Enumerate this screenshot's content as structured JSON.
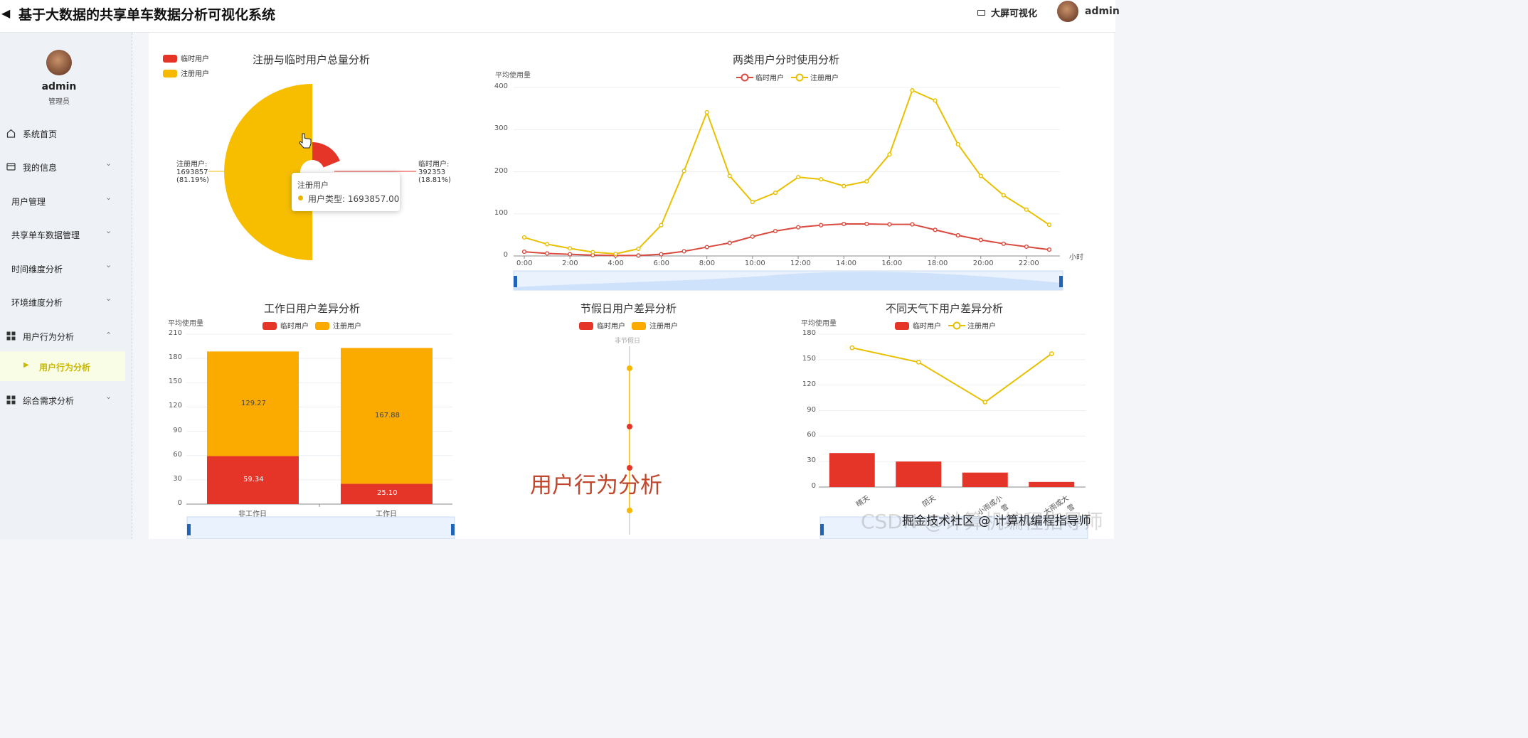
{
  "topbar": {
    "title": "基于大数据的共享单车数据分析可视化系统",
    "big_screen_label": "大屏可视化",
    "user": "admin"
  },
  "sidebar": {
    "username": "admin",
    "role": "管理员",
    "items": [
      {
        "label": "系统首页",
        "icon": "home-icon"
      },
      {
        "label": "我的信息",
        "icon": "card-icon"
      },
      {
        "label": "用户管理"
      },
      {
        "label": "共享单车数据管理"
      },
      {
        "label": "时间维度分析"
      },
      {
        "label": "环境维度分析"
      },
      {
        "label": "用户行为分析",
        "icon": "grid-icon"
      },
      {
        "label": "用户行为分析"
      },
      {
        "label": "综合需求分析",
        "icon": "grid-icon"
      }
    ]
  },
  "colors": {
    "temp": "#e53428",
    "reg": "#f7b900",
    "reg_bar": "#fbab00"
  },
  "overlay_text": "用户行为分析",
  "watermark_text": "CSDN @计算机编程指导师",
  "watermark_credit": "掘金技术社区 @ 计算机编程指导师",
  "charts": {
    "pie": {
      "title": "注册与临时用户总量分析",
      "legend": [
        "临时用户",
        "注册用户"
      ],
      "reg_label": [
        "注册用户:",
        "1693857",
        "(81.19%)"
      ],
      "temp_label": [
        "临时用户:",
        "392353",
        "(18.81%)"
      ],
      "tooltip_title": "注册用户",
      "tooltip_value": "用户类型: 1693857.00"
    },
    "line": {
      "title": "两类用户分时使用分析",
      "legend": [
        "临时用户",
        "注册用户"
      ],
      "ylabel": "平均使用量",
      "xunit": "小时",
      "yticks": [
        "0",
        "100",
        "200",
        "300",
        "400"
      ],
      "xticks": [
        "0:00",
        "2:00",
        "4:00",
        "6:00",
        "8:00",
        "10:00",
        "12:00",
        "14:00",
        "16:00",
        "18:00",
        "20:00",
        "22:00"
      ]
    },
    "workday": {
      "title": "工作日用户差异分析",
      "legend": [
        "临时用户",
        "注册用户"
      ],
      "ylabel": "平均使用量",
      "yticks": [
        "0",
        "30",
        "60",
        "90",
        "120",
        "150",
        "180",
        "210"
      ],
      "categories": [
        "非工作日",
        "工作日"
      ],
      "temp_labels": [
        "59.34",
        "25.10"
      ],
      "reg_labels": [
        "129.27",
        "167.88"
      ]
    },
    "holiday": {
      "title": "节假日用户差异分析",
      "legend": [
        "临时用户",
        "注册用户"
      ],
      "category": "非节假日"
    },
    "weather": {
      "title": "不同天气下用户差异分析",
      "legend": [
        "临时用户",
        "注册用户"
      ],
      "ylabel": "平均使用量",
      "yticks": [
        "0",
        "30",
        "60",
        "90",
        "120",
        "150",
        "180"
      ],
      "categories": [
        "晴天",
        "阴天",
        "小雨或小雪",
        "大雨或大雪"
      ]
    }
  },
  "chart_data": [
    {
      "type": "pie",
      "title": "注册与临时用户总量分析",
      "categories": [
        "注册用户",
        "临时用户"
      ],
      "values": [
        1693857,
        392353
      ],
      "percent": [
        81.19,
        18.81
      ]
    },
    {
      "type": "line",
      "title": "两类用户分时使用分析",
      "ylabel": "平均使用量",
      "xlabel": "小时",
      "ylim": [
        0,
        400
      ],
      "x": [
        "0:00",
        "1:00",
        "2:00",
        "3:00",
        "4:00",
        "5:00",
        "6:00",
        "7:00",
        "8:00",
        "9:00",
        "10:00",
        "11:00",
        "12:00",
        "13:00",
        "14:00",
        "15:00",
        "16:00",
        "17:00",
        "18:00",
        "19:00",
        "20:00",
        "21:00",
        "22:00",
        "23:00"
      ],
      "series": [
        {
          "name": "临时用户",
          "values": [
            10,
            6,
            4,
            2,
            1,
            1,
            4,
            11,
            21,
            31,
            46,
            59,
            68,
            73,
            76,
            76,
            75,
            75,
            62,
            49,
            38,
            29,
            22,
            15
          ]
        },
        {
          "name": "注册用户",
          "values": [
            44,
            28,
            18,
            9,
            5,
            17,
            73,
            202,
            341,
            190,
            128,
            150,
            187,
            182,
            166,
            177,
            241,
            393,
            369,
            265,
            190,
            144,
            110,
            74
          ]
        }
      ]
    },
    {
      "type": "bar",
      "title": "工作日用户差异分析",
      "ylabel": "平均使用量",
      "ylim": [
        0,
        210
      ],
      "categories": [
        "非工作日",
        "工作日"
      ],
      "series": [
        {
          "name": "临时用户",
          "values": [
            59.34,
            25.1
          ]
        },
        {
          "name": "注册用户",
          "values": [
            129.27,
            167.88
          ]
        }
      ]
    },
    {
      "type": "scatter",
      "title": "节假日用户差异分析",
      "categories": [
        "非节假日"
      ],
      "series": [
        {
          "name": "注册用户",
          "values": [
            180,
            25
          ]
        },
        {
          "name": "临时用户",
          "values": [
            110,
            50
          ]
        }
      ]
    },
    {
      "type": "bar",
      "title": "不同天气下用户差异分析",
      "ylabel": "平均使用量",
      "ylim": [
        0,
        180
      ],
      "categories": [
        "晴天",
        "阴天",
        "小雨或小雪",
        "大雨或大雪"
      ],
      "series": [
        {
          "name": "临时用户",
          "type": "bar",
          "values": [
            40,
            30,
            17,
            6
          ]
        },
        {
          "name": "注册用户",
          "type": "line",
          "values": [
            164,
            147,
            100,
            157
          ]
        }
      ]
    }
  ]
}
